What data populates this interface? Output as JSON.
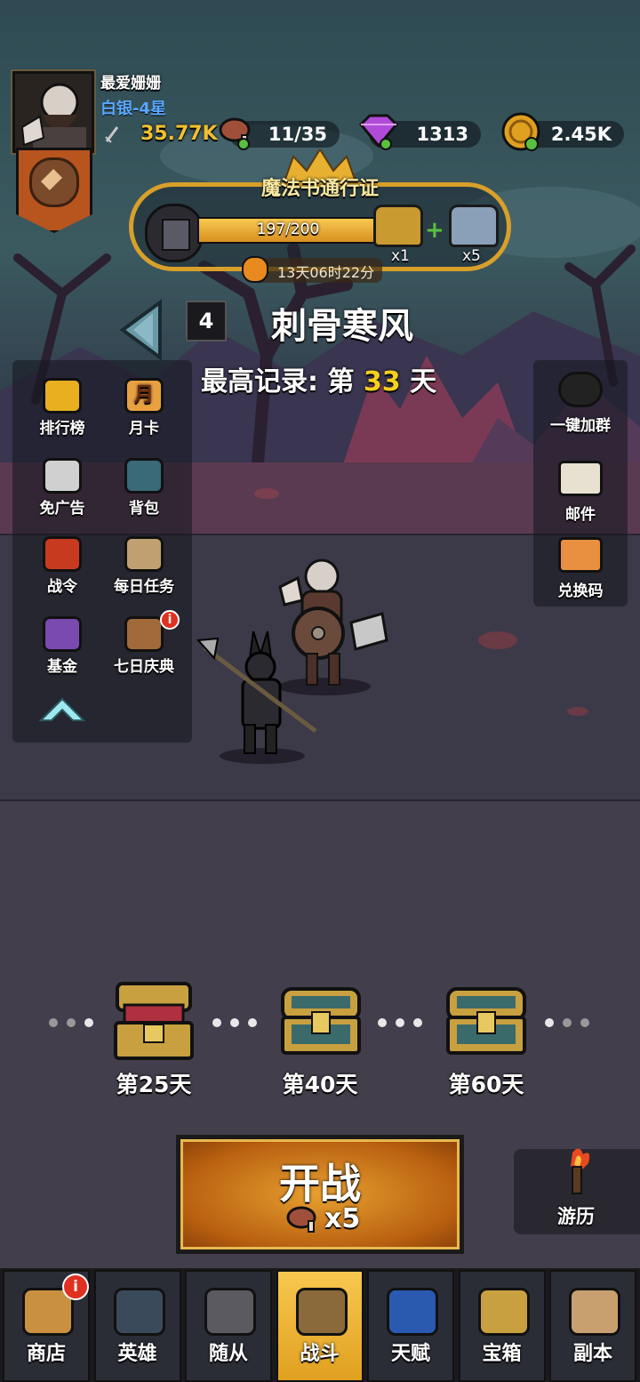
{
  "player": {
    "name": "最爱姗姗",
    "rank": "白银-4星",
    "power": "35.77K"
  },
  "resources": {
    "stamina": "11/35",
    "gems": "1313",
    "gold": "2.45K"
  },
  "pass": {
    "title": "魔法书通行证",
    "progress_text": "197/200",
    "progress": 0.985,
    "reward1_count": "x1",
    "reward2_count": "x5",
    "timer": "13天06时22分"
  },
  "stage": {
    "number": "4",
    "name": "刺骨寒风",
    "record_prefix": "最高记录: 第",
    "record_day": "33",
    "record_suffix": "天"
  },
  "left_menu": [
    {
      "label": "排行榜",
      "icon": "trophy-icon"
    },
    {
      "label": "月卡",
      "icon": "month-card-icon",
      "glyph": "月"
    },
    {
      "label": "免广告",
      "icon": "no-ads-icon"
    },
    {
      "label": "背包",
      "icon": "backpack-icon"
    },
    {
      "label": "战令",
      "icon": "battle-order-icon"
    },
    {
      "label": "每日任务",
      "icon": "daily-task-icon"
    },
    {
      "label": "基金",
      "icon": "fund-bag-icon"
    },
    {
      "label": "七日庆典",
      "icon": "seven-day-chest-icon"
    }
  ],
  "right_menu": [
    {
      "label": "一键加群",
      "icon": "qq-penguin-icon"
    },
    {
      "label": "邮件",
      "icon": "mail-icon"
    },
    {
      "label": "兑换码",
      "icon": "ticket-icon"
    }
  ],
  "milestones": [
    {
      "label": "第25天"
    },
    {
      "label": "第40天"
    },
    {
      "label": "第60天"
    }
  ],
  "battle_button": {
    "label": "开战",
    "cost": "x5"
  },
  "travel": {
    "label": "游历"
  },
  "tabs": [
    {
      "label": "商店",
      "icon": "shop-icon"
    },
    {
      "label": "英雄",
      "icon": "hero-helmet-icon"
    },
    {
      "label": "随从",
      "icon": "follower-icon"
    },
    {
      "label": "战斗",
      "icon": "battle-swords-icon"
    },
    {
      "label": "天赋",
      "icon": "talent-shield-icon"
    },
    {
      "label": "宝箱",
      "icon": "treasure-chest-icon"
    },
    {
      "label": "副本",
      "icon": "dungeon-scroll-icon"
    }
  ],
  "colors": {
    "gold_accent": "#d8a02a",
    "record_highlight": "#f5d020",
    "rank_blue": "#5aa8ff",
    "active_tab": "#f2b233",
    "battle_button": "#d07a12"
  }
}
